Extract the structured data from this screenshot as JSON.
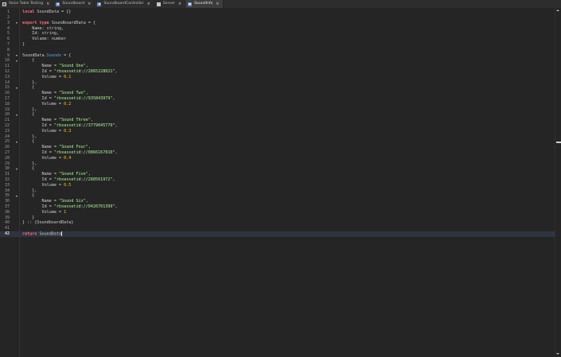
{
  "tabs": [
    {
      "label": "Voice Table Testing",
      "icon": "script-icon",
      "active": false
    },
    {
      "label": "Soundboard",
      "icon": "module-script-icon",
      "active": false
    },
    {
      "label": "SoundboardController",
      "icon": "module-script-icon",
      "active": false
    },
    {
      "label": "Server",
      "icon": "server-script-icon",
      "active": false
    },
    {
      "label": "SoundInfo",
      "icon": "module-script-icon",
      "active": true
    }
  ],
  "close_glyph": "×",
  "editor": {
    "current_line": 42,
    "fold_lines": [
      3,
      9,
      10,
      15,
      20,
      25,
      30,
      35
    ],
    "lines": [
      [
        [
          "kw",
          "local"
        ],
        [
          "id",
          " SoundData = {}"
        ]
      ],
      [],
      [
        [
          "kw",
          "export"
        ],
        [
          "id",
          " "
        ],
        [
          "kw",
          "type"
        ],
        [
          "id",
          " SoundboardData = {"
        ]
      ],
      [
        [
          "id",
          "    Name: "
        ],
        [
          "type",
          "string"
        ],
        [
          "id",
          ","
        ]
      ],
      [
        [
          "id",
          "    Id: "
        ],
        [
          "type",
          "string"
        ],
        [
          "id",
          ","
        ]
      ],
      [
        [
          "id",
          "    Volume: "
        ],
        [
          "type",
          "number"
        ]
      ],
      [
        [
          "id",
          "}"
        ]
      ],
      [],
      [
        [
          "id",
          "SoundData."
        ],
        [
          "prop",
          "Sounds"
        ],
        [
          "id",
          " = {"
        ]
      ],
      [
        [
          "id",
          "    {"
        ]
      ],
      [
        [
          "id",
          "        Name = "
        ],
        [
          "str",
          "\"Sound One\""
        ],
        [
          "id",
          ","
        ]
      ],
      [
        [
          "id",
          "        Id = "
        ],
        [
          "str",
          "\"rbxassetid://2865228021\""
        ],
        [
          "id",
          ","
        ]
      ],
      [
        [
          "id",
          "        Volume = "
        ],
        [
          "num",
          "0.1"
        ]
      ],
      [
        [
          "id",
          "    },"
        ]
      ],
      [
        [
          "id",
          "    {"
        ]
      ],
      [
        [
          "id",
          "        Name = "
        ],
        [
          "str",
          "\"Sound Two\""
        ],
        [
          "id",
          ","
        ]
      ],
      [
        [
          "id",
          "        Id = "
        ],
        [
          "str",
          "\"rbxassetid://935843979\""
        ],
        [
          "id",
          ","
        ]
      ],
      [
        [
          "id",
          "        Volume = "
        ],
        [
          "num",
          "0.2"
        ]
      ],
      [
        [
          "id",
          "    },"
        ]
      ],
      [
        [
          "id",
          "    {"
        ]
      ],
      [
        [
          "id",
          "        Name = "
        ],
        [
          "str",
          "\"Sound Three\""
        ],
        [
          "id",
          ","
        ]
      ],
      [
        [
          "id",
          "        Id = "
        ],
        [
          "str",
          "\"rbxassetid://3779045779\""
        ],
        [
          "id",
          ","
        ]
      ],
      [
        [
          "id",
          "        Volume = "
        ],
        [
          "num",
          "0.3"
        ]
      ],
      [
        [
          "id",
          "    },"
        ]
      ],
      [
        [
          "id",
          "    {"
        ]
      ],
      [
        [
          "id",
          "        Name = "
        ],
        [
          "str",
          "\"Sound Four\""
        ],
        [
          "id",
          ","
        ]
      ],
      [
        [
          "id",
          "        Id = "
        ],
        [
          "str",
          "\"rbxassetid://0866167810\""
        ],
        [
          "id",
          ","
        ]
      ],
      [
        [
          "id",
          "        Volume = "
        ],
        [
          "num",
          "0.4"
        ]
      ],
      [
        [
          "id",
          "    },"
        ]
      ],
      [
        [
          "id",
          "    {"
        ]
      ],
      [
        [
          "id",
          "        Name = "
        ],
        [
          "str",
          "\"Sound Five\""
        ],
        [
          "id",
          ","
        ]
      ],
      [
        [
          "id",
          "        Id = "
        ],
        [
          "str",
          "\"rbxassetid://288561972\""
        ],
        [
          "id",
          ","
        ]
      ],
      [
        [
          "id",
          "        Volume = "
        ],
        [
          "num",
          "0.5"
        ]
      ],
      [
        [
          "id",
          "    },"
        ]
      ],
      [
        [
          "id",
          "    {"
        ]
      ],
      [
        [
          "id",
          "        Name = "
        ],
        [
          "str",
          "\"Sound Six\""
        ],
        [
          "id",
          ","
        ]
      ],
      [
        [
          "id",
          "        Id = "
        ],
        [
          "str",
          "\"rbxassetid://0426701399\""
        ],
        [
          "id",
          ","
        ]
      ],
      [
        [
          "id",
          "        Volume = "
        ],
        [
          "num",
          "1"
        ]
      ],
      [
        [
          "id",
          "    }"
        ]
      ],
      [
        [
          "id",
          "} :: {SoundboardData}"
        ]
      ],
      [],
      [
        [
          "kw",
          "return"
        ],
        [
          "id",
          " SoundData"
        ]
      ]
    ]
  },
  "colors": {
    "background": "#252526",
    "keyword": "#f86d7c",
    "string": "#adf195",
    "number": "#ffc600",
    "property": "#61a1f1",
    "current_line": "#2f3540"
  }
}
